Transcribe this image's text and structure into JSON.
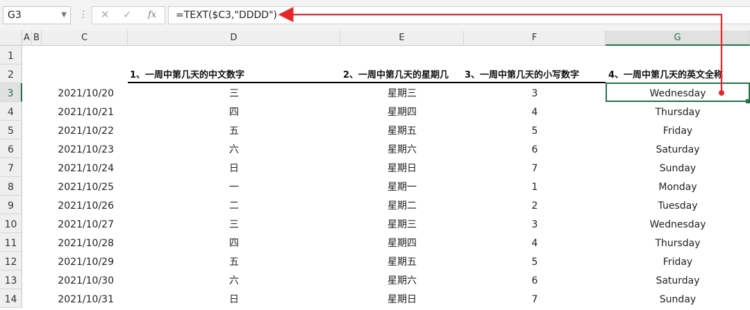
{
  "formula_bar": {
    "name_box": "G3",
    "cancel_icon": "✕",
    "enter_icon": "✓",
    "fx_label": "fx",
    "formula": "=TEXT($C3,\"DDDD\")"
  },
  "columns": [
    "A",
    "B",
    "C",
    "D",
    "E",
    "F",
    "G"
  ],
  "rows": [
    "1",
    "2",
    "3",
    "4",
    "5",
    "6",
    "7",
    "8",
    "9",
    "10",
    "11",
    "12",
    "13",
    "14"
  ],
  "selected_cell": "G3",
  "headers": {
    "d": "1、一周中第几天的中文数字",
    "e": "2、一周中第几天的星期几",
    "f": "3、一周中第几天的小写数字",
    "g": "4、一周中第几天的英文全称"
  },
  "table": [
    {
      "date": "2021/10/20",
      "cn": "三",
      "week": "星期三",
      "num": "3",
      "en": "Wednesday"
    },
    {
      "date": "2021/10/21",
      "cn": "四",
      "week": "星期四",
      "num": "4",
      "en": "Thursday"
    },
    {
      "date": "2021/10/22",
      "cn": "五",
      "week": "星期五",
      "num": "5",
      "en": "Friday"
    },
    {
      "date": "2021/10/23",
      "cn": "六",
      "week": "星期六",
      "num": "6",
      "en": "Saturday"
    },
    {
      "date": "2021/10/24",
      "cn": "日",
      "week": "星期日",
      "num": "7",
      "en": "Sunday"
    },
    {
      "date": "2021/10/25",
      "cn": "一",
      "week": "星期一",
      "num": "1",
      "en": "Monday"
    },
    {
      "date": "2021/10/26",
      "cn": "二",
      "week": "星期二",
      "num": "2",
      "en": "Tuesday"
    },
    {
      "date": "2021/10/27",
      "cn": "三",
      "week": "星期三",
      "num": "3",
      "en": "Wednesday"
    },
    {
      "date": "2021/10/28",
      "cn": "四",
      "week": "星期四",
      "num": "4",
      "en": "Thursday"
    },
    {
      "date": "2021/10/29",
      "cn": "五",
      "week": "星期五",
      "num": "5",
      "en": "Friday"
    },
    {
      "date": "2021/10/30",
      "cn": "六",
      "week": "星期六",
      "num": "6",
      "en": "Saturday"
    },
    {
      "date": "2021/10/31",
      "cn": "日",
      "week": "星期日",
      "num": "7",
      "en": "Sunday"
    }
  ],
  "colors": {
    "accent_green": "#217346",
    "arrow_red": "#e8262a"
  }
}
